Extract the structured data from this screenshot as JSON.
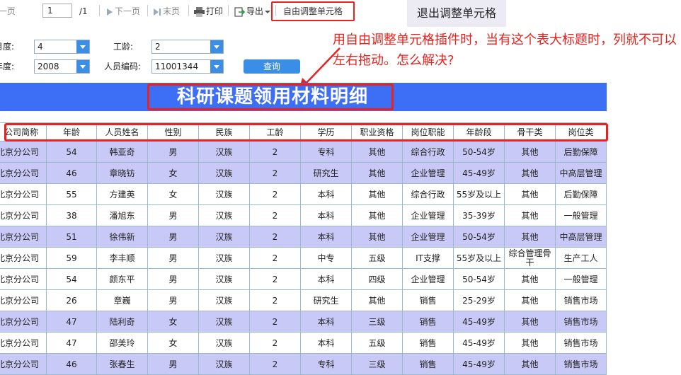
{
  "toolbar": {
    "prev_label": "上一页",
    "page_value": "1",
    "page_total": "/1",
    "next_label": "下一页",
    "last_label": "末页",
    "print_label": "打印",
    "export_label": "导出",
    "free_adjust_label": "自由调整单元格",
    "exit_adjust_label": "退出调整单元格"
  },
  "params": {
    "month_label": "月度:",
    "month_value": "4",
    "seniority_label": "工龄:",
    "seniority_value": "2",
    "year_label": "年度:",
    "year_value": "2008",
    "employee_code_label": "人员编码:",
    "employee_code_value": "11001344",
    "query_label": "查询"
  },
  "annotation": "用自由调整单元格插件时，当有这个表大标题时，列就不可以左右拖动。怎么解决?",
  "report": {
    "title": "科研课题领用材料明细",
    "headers": [
      "公司简称",
      "年龄",
      "人员姓名",
      "性别",
      "民族",
      "工龄",
      "学历",
      "职业资格",
      "岗位职能",
      "年龄段",
      "骨干类",
      "岗位类"
    ],
    "rows": [
      [
        "北京分公司",
        "54",
        "韩亚奇",
        "男",
        "汉族",
        "2",
        "专科",
        "其他",
        "综合行政",
        "50-54岁",
        "其他",
        "后勤保障"
      ],
      [
        "北京分公司",
        "46",
        "章晓钫",
        "女",
        "汉族",
        "2",
        "研究生",
        "其他",
        "企业管理",
        "45-49岁",
        "其他",
        "中高层管理"
      ],
      [
        "北京分公司",
        "55",
        "方建英",
        "女",
        "汉族",
        "2",
        "本科",
        "其他",
        "综合行政",
        "55岁及以上",
        "其他",
        "后勤保障"
      ],
      [
        "北京分公司",
        "38",
        "潘旭东",
        "男",
        "汉族",
        "2",
        "本科",
        "其他",
        "企业管理",
        "35-39岁",
        "其他",
        "一般管理"
      ],
      [
        "北京分公司",
        "51",
        "徐伟新",
        "男",
        "汉族",
        "2",
        "本科",
        "其他",
        "企业管理",
        "50-54岁",
        "其他",
        "中高层管理"
      ],
      [
        "北京分公司",
        "59",
        "李丰顺",
        "男",
        "汉族",
        "2",
        "中专",
        "五级",
        "IT支撑",
        "55岁及以上",
        "综合管理骨干",
        "生产工人"
      ],
      [
        "北京分公司",
        "54",
        "颜东平",
        "男",
        "汉族",
        "2",
        "本科",
        "四级",
        "企业管理",
        "50-54岁",
        "其他",
        "一般管理"
      ],
      [
        "北京分公司",
        "26",
        "章巍",
        "男",
        "汉族",
        "2",
        "研究生",
        "其他",
        "销售",
        "25-29岁",
        "其他",
        "销售市场"
      ],
      [
        "北京分公司",
        "47",
        "陆利奇",
        "女",
        "汉族",
        "2",
        "本科",
        "三级",
        "销售",
        "45-49岁",
        "其他",
        "销售市场"
      ],
      [
        "北京分公司",
        "47",
        "邵美玲",
        "女",
        "汉族",
        "2",
        "本科",
        "五级",
        "销售",
        "45-49岁",
        "其他",
        "销售市场"
      ],
      [
        "北京分公司",
        "46",
        "张春生",
        "男",
        "汉族",
        "2",
        "专科",
        "三级",
        "销售",
        "45-49岁",
        "其他",
        "销售市场"
      ]
    ]
  },
  "colors": {
    "title_bar": "#3c6ff5",
    "alt_row": "#c9c9f7",
    "highlight": "#e8231e",
    "button": "#3a8ee6"
  }
}
